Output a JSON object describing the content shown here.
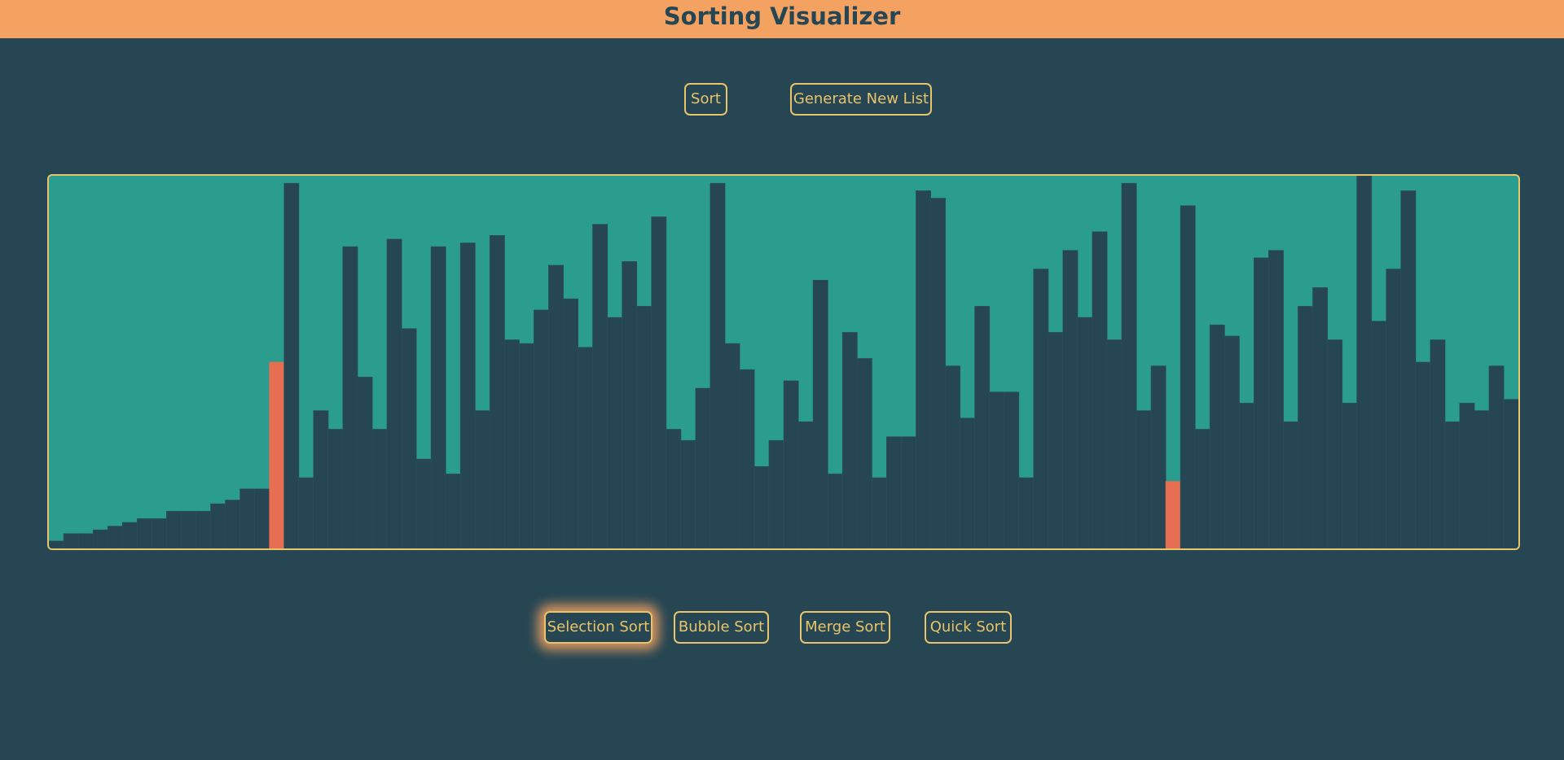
{
  "header": {
    "title": "Sorting Visualizer"
  },
  "controls": {
    "sort_label": "Sort",
    "generate_label": "Generate New List"
  },
  "algorithms": {
    "selection": "Selection Sort",
    "bubble": "Bubble Sort",
    "merge": "Merge Sort",
    "quick": "Quick Sort",
    "selected": "Selection Sort"
  },
  "colors": {
    "background": "#264653",
    "header": "#f4a261",
    "panel": "#2a9d8f",
    "accent": "#e9c46a",
    "bar": "#264653",
    "highlight": "#e76f51"
  },
  "chart_data": {
    "type": "bar",
    "max_value": 100,
    "values": [
      2,
      4,
      4,
      5,
      6,
      7,
      8,
      8,
      10,
      10,
      10,
      12,
      13,
      16,
      16,
      50,
      98,
      19,
      37,
      32,
      81,
      46,
      32,
      83,
      59,
      24,
      81,
      20,
      82,
      37,
      84,
      56,
      55,
      64,
      76,
      67,
      54,
      87,
      62,
      77,
      65,
      89,
      32,
      29,
      43,
      98,
      55,
      48,
      22,
      29,
      45,
      34,
      72,
      20,
      58,
      51,
      19,
      30,
      30,
      96,
      94,
      49,
      35,
      65,
      42,
      42,
      19,
      75,
      58,
      80,
      62,
      85,
      56,
      98,
      37,
      49,
      18,
      92,
      32,
      60,
      57,
      39,
      78,
      80,
      34,
      65,
      70,
      56,
      39,
      100,
      61,
      75,
      96,
      50,
      56,
      34,
      39,
      37,
      49,
      40
    ],
    "highlighted": [
      15,
      76
    ]
  }
}
